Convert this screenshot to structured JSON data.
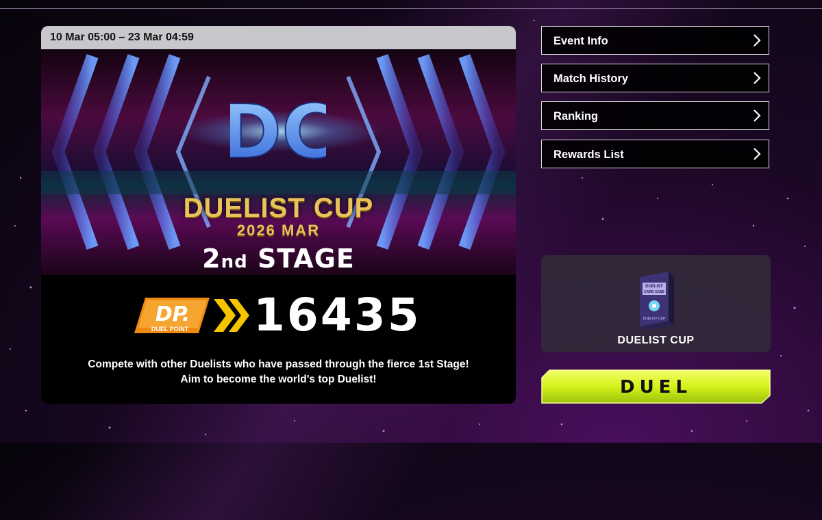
{
  "event": {
    "period": "10 Mar 05:00 – 23 Mar 04:59",
    "logo_letters": "DC",
    "title": "DUELIST CUP",
    "subtitle": "2026 MAR",
    "stage_number": "2",
    "stage_ordinal": "nd",
    "stage_word": "STAGE",
    "dp_badge_main": "DP.",
    "dp_badge_sub": "DUEL POINT",
    "duel_points": "16435",
    "description_line1": "Compete with other Duelists who have passed through the fierce 1st Stage!",
    "description_line2": "Aim to become the world's top Duelist!"
  },
  "menu": [
    {
      "label": "Event Info",
      "icon": "chevron-right-icon"
    },
    {
      "label": "Match History",
      "icon": "chevron-right-icon"
    },
    {
      "label": "Ranking",
      "icon": "chevron-right-icon"
    },
    {
      "label": "Rewards List",
      "icon": "chevron-right-icon"
    }
  ],
  "deck": {
    "case_line1": "DUELIST",
    "case_line2": "CARD CASE",
    "case_brand": "DUELIST CUP",
    "label": "DUELIST CUP"
  },
  "duel_button": {
    "label": "DUEL"
  },
  "colors": {
    "accent_gold": "#e8c35a",
    "duel_green": "#d4f21a",
    "dp_orange": "#f08a12",
    "period_bar": "#c8c8cc"
  }
}
